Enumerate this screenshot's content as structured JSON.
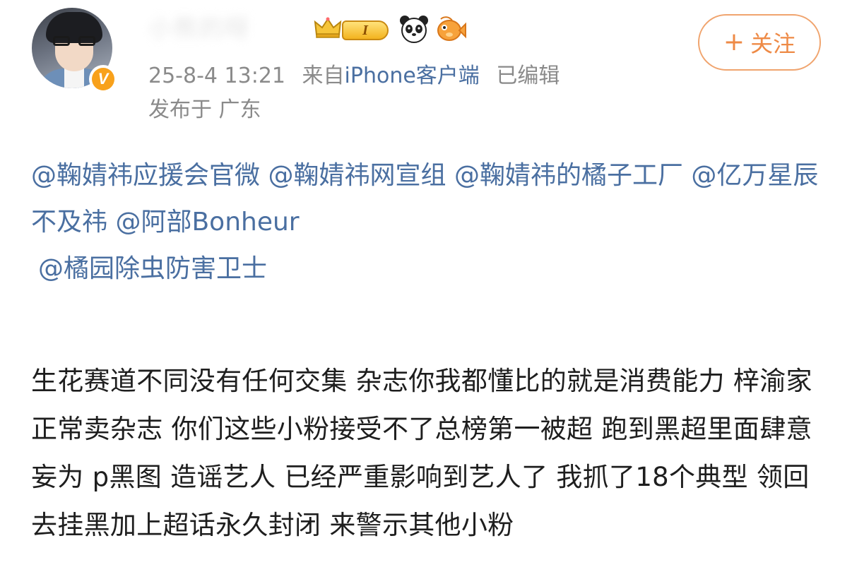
{
  "post": {
    "author": {
      "username": "小熊的呀",
      "verified_badge": "V",
      "level_badge": "I",
      "emoji_badges": [
        "panda-icon",
        "fish-icon"
      ]
    },
    "date_time": "25-8-4 13:21",
    "source_prefix": "来自",
    "source_client": "iPhone客户端",
    "edited_label": "已编辑",
    "location": "发布于 广东",
    "follow_button": {
      "plus": "+",
      "label": "关注"
    },
    "mentions": [
      "@鞠婧祎应援会官微",
      "@鞠婧祎网宣组",
      "@鞠婧祎的橘子工厂",
      "@亿万星辰不及祎",
      "@阿部Bonheur",
      "@橘园除虫防害卫士"
    ],
    "body": "生花赛道不同没有任何交集 杂志你我都懂比的就是消费能力 梓渝家正常卖杂志 你们这些小粉接受不了总榜第一被超 跑到黑超里面肆意妄为 p黑图 造谣艺人 已经严重影响到艺人了 我抓了18个典型 领回去挂黑加上超话永久封闭 来警示其他小粉"
  },
  "colors": {
    "link": "#4a6fa1",
    "meta": "#8a8a8a",
    "follow": "#ee8a46",
    "verified": "#f8a11b"
  }
}
